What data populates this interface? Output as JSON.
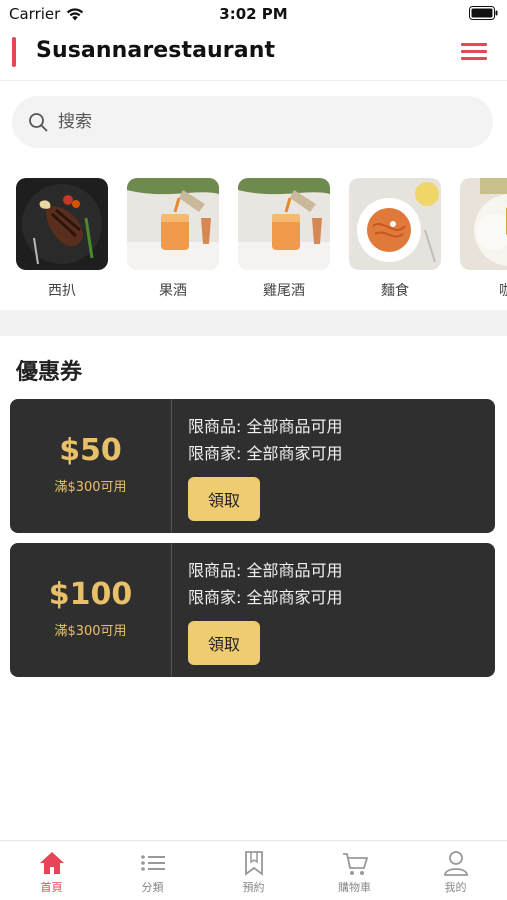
{
  "status_bar": {
    "carrier": "Carrier",
    "time": "3:02 PM"
  },
  "header": {
    "title": "Susannarestaurant",
    "accent_color": "#e84558"
  },
  "search": {
    "placeholder": "搜索"
  },
  "categories": [
    {
      "label": "西扒",
      "image": "steak"
    },
    {
      "label": "果酒",
      "image": "fruit-wine"
    },
    {
      "label": "雞尾酒",
      "image": "cocktail"
    },
    {
      "label": "麵食",
      "image": "noodles"
    },
    {
      "label": "咖",
      "image": "curry-rice"
    }
  ],
  "coupons_section": {
    "title": "優惠券"
  },
  "coupons": [
    {
      "amount": "$50",
      "condition": "滿$300可用",
      "product_scope": "限商品: 全部商品可用",
      "merchant_scope": "限商家: 全部商家可用",
      "button": "領取"
    },
    {
      "amount": "$100",
      "condition": "滿$300可用",
      "product_scope": "限商品: 全部商品可用",
      "merchant_scope": "限商家: 全部商家可用",
      "button": "領取"
    }
  ],
  "tabs": [
    {
      "label": "首頁",
      "icon": "home-icon",
      "active": true
    },
    {
      "label": "分類",
      "icon": "list-icon",
      "active": false
    },
    {
      "label": "預約",
      "icon": "bookmark-icon",
      "active": false
    },
    {
      "label": "購物車",
      "icon": "cart-icon",
      "active": false
    },
    {
      "label": "我的",
      "icon": "person-icon",
      "active": false
    }
  ],
  "colors": {
    "accent": "#e84558",
    "coupon_bg": "#2f2f2f",
    "coupon_gold": "#e8c06a",
    "button_gold": "#efcb72"
  }
}
